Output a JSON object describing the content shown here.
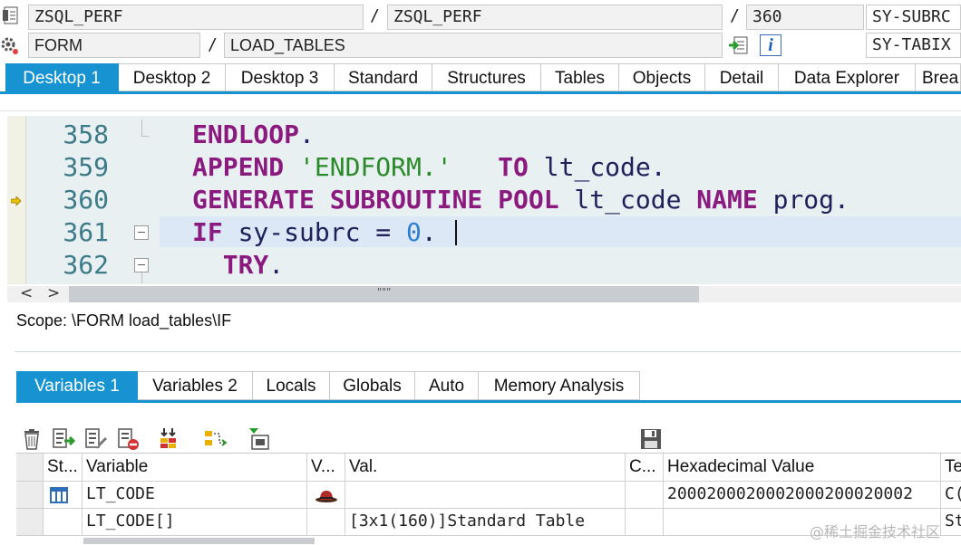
{
  "header": {
    "row1": {
      "program": "ZSQL_PERF",
      "sep1": "/",
      "include": "ZSQL_PERF",
      "sep2": "/",
      "line": "360",
      "sysvar": "SY-SUBRC"
    },
    "row2": {
      "event_type": "FORM",
      "sep": "/",
      "event_name": "LOAD_TABLES",
      "sysvar": "SY-TABIX"
    },
    "info_icon_text": "i"
  },
  "desktop_tabs": [
    "Desktop 1",
    "Desktop 2",
    "Desktop 3",
    "Standard",
    "Structures",
    "Tables",
    "Objects",
    "Detail",
    "Data Explorer",
    "Brea"
  ],
  "editor": {
    "lines": [
      {
        "num": "358",
        "tokens": [
          {
            "t": "ENDLOOP",
            "c": "kw"
          },
          {
            "t": ".",
            "c": ""
          }
        ]
      },
      {
        "num": "359",
        "tokens": [
          {
            "t": "APPEND",
            "c": "kw"
          },
          {
            "t": " ",
            "c": ""
          },
          {
            "t": "'ENDFORM.'",
            "c": "str"
          },
          {
            "t": "   ",
            "c": ""
          },
          {
            "t": "TO",
            "c": "kw"
          },
          {
            "t": " lt_code.",
            "c": ""
          }
        ]
      },
      {
        "num": "360",
        "tokens": [
          {
            "t": "GENERATE SUBROUTINE POOL",
            "c": "kw"
          },
          {
            "t": " lt_code ",
            "c": ""
          },
          {
            "t": "NAME",
            "c": "kw"
          },
          {
            "t": " prog.",
            "c": ""
          }
        ]
      },
      {
        "num": "361",
        "tokens": [
          {
            "t": "IF",
            "c": "kw"
          },
          {
            "t": " sy-subrc = ",
            "c": ""
          },
          {
            "t": "0",
            "c": "num"
          },
          {
            "t": ".",
            "c": ""
          }
        ]
      },
      {
        "num": "362",
        "tokens": [
          {
            "t": "  TRY",
            "c": "kw"
          },
          {
            "t": ".",
            "c": ""
          }
        ]
      }
    ],
    "scroll_grip": "\"\"\"",
    "scroll_left": "<",
    "scroll_right": ">"
  },
  "scope": "Scope: \\FORM load_tables\\IF",
  "variable_tabs": [
    "Variables 1",
    "Variables 2",
    "Locals",
    "Globals",
    "Auto",
    "Memory Analysis"
  ],
  "toolbar_icons": [
    "trash-icon",
    "insert-row-icon",
    "edit-row-icon",
    "delete-row-icon",
    "transfer-icon",
    "swap-icon",
    "import-icon",
    "save-icon"
  ],
  "grid": {
    "headers": [
      "St...",
      "Variable",
      "V...",
      "Val.",
      "C...",
      "Hexadecimal Value",
      "Te"
    ],
    "rows": [
      {
        "status_icon": "table-icon",
        "variable": "LT_CODE",
        "v_icon": "hat-icon",
        "val": "",
        "c": "",
        "hex": "2000200020002000200020002",
        "te": "C("
      },
      {
        "status_icon": "",
        "variable": "LT_CODE[]",
        "v_icon": "",
        "val": "[3x1(160)]Standard Table",
        "c": "",
        "hex": "",
        "te": "St"
      }
    ]
  },
  "watermark": "@稀土掘金技术社区"
}
